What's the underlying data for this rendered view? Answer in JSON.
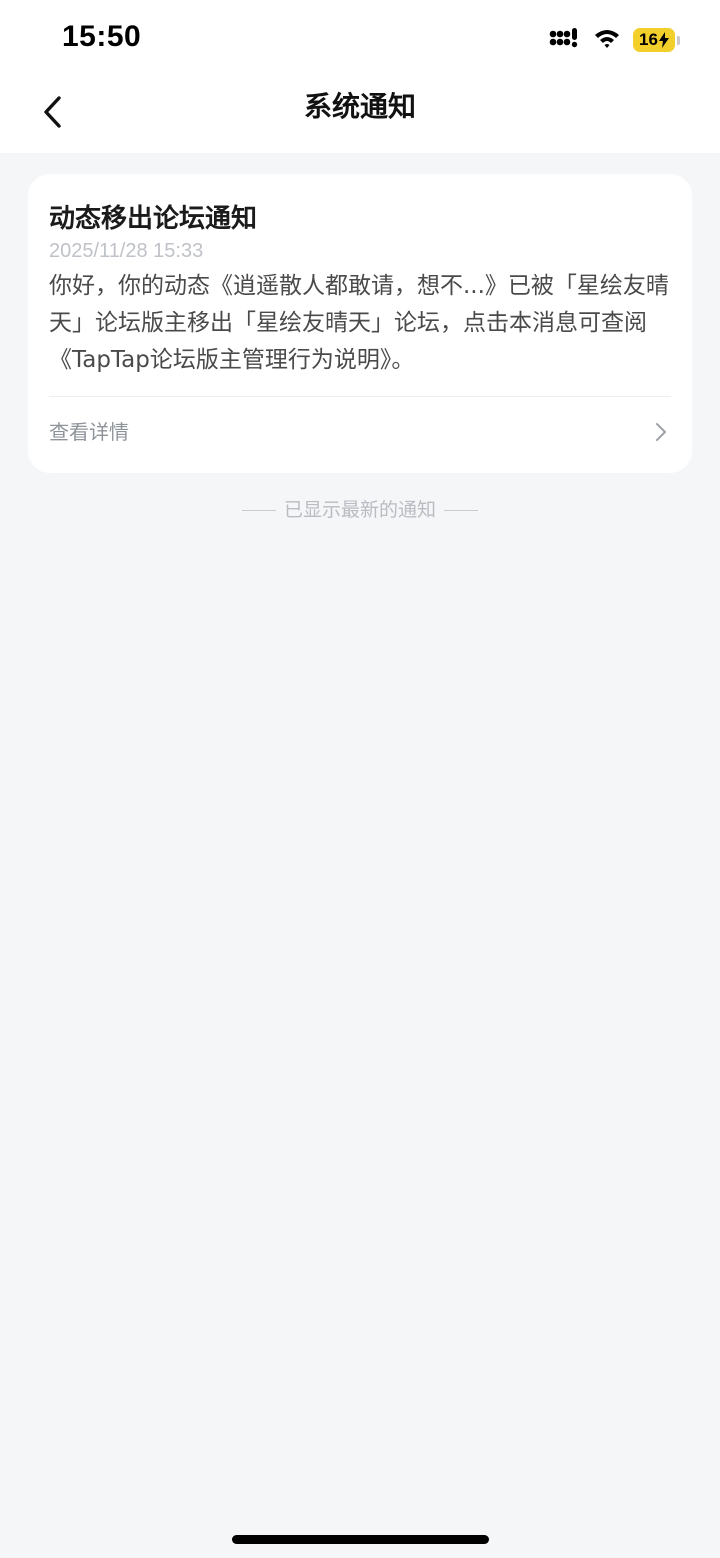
{
  "status_bar": {
    "time": "15:50",
    "battery": "16",
    "battery_color": "#f2cf2b",
    "icons": [
      "cellular-signal-icon",
      "wifi-icon",
      "battery-charging-icon"
    ]
  },
  "nav": {
    "back_icon": "chevron-left-icon",
    "title": "系统通知"
  },
  "notification": {
    "title": "动态移出论坛通知",
    "time": "2025/11/28 15:33",
    "body": "你好，你的动态《逍遥散人都敢请，想不...》已被「星绘友晴天」论坛版主移出「星绘友晴天」论坛，点击本消息可查阅《TapTap论坛版主管理行为说明》。",
    "detail_label": "查看详情",
    "detail_icon": "chevron-right-icon"
  },
  "footer": {
    "end_text": "已显示最新的通知"
  }
}
